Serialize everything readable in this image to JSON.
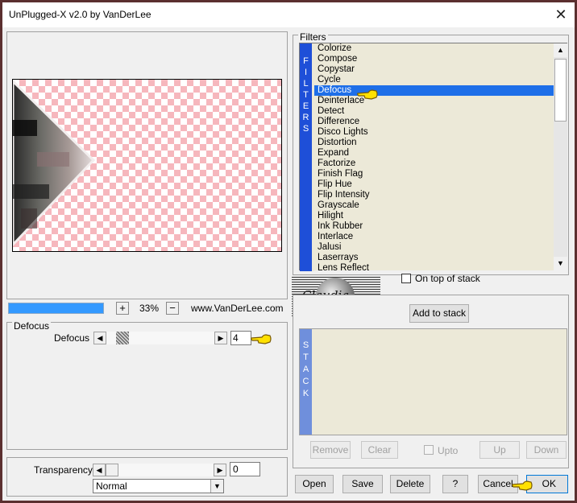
{
  "window": {
    "title": "UnPlugged-X v2.0 by VanDerLee",
    "close_glyph": "✕"
  },
  "filters": {
    "group_label": "Filters",
    "side_label": [
      "F",
      "I",
      "L",
      "T",
      "E",
      "R",
      "S"
    ],
    "items": [
      "Colorize",
      "Compose",
      "Copystar",
      "Cycle",
      "Defocus",
      "Deinterlace",
      "Detect",
      "Difference",
      "Disco Lights",
      "Distortion",
      "Expand",
      "Factorize",
      "Finish Flag",
      "Flip Hue",
      "Flip Intensity",
      "Grayscale",
      "Hilight",
      "Ink Rubber",
      "Interlace",
      "Jalusi",
      "Laserrays",
      "Lens Reflect"
    ],
    "selected": "Defocus",
    "on_top_label": "On top of stack"
  },
  "zoom": {
    "minus": "−",
    "plus": "+",
    "value": "33%",
    "website": "www.VanDerLee.com"
  },
  "params": {
    "group_label": "Defocus",
    "defocus_label": "Defocus",
    "defocus_value": "4",
    "transparency_label": "Transparency",
    "transparency_value": "0",
    "blend_mode": "Normal"
  },
  "stack": {
    "add_label": "Add to stack",
    "side_label": [
      "S",
      "T",
      "A",
      "C",
      "K"
    ],
    "remove_label": "Remove",
    "clear_label": "Clear",
    "upto_label": "Upto",
    "up_label": "Up",
    "down_label": "Down",
    "watermark": "Claudia"
  },
  "footer": {
    "open_label": "Open",
    "save_label": "Save",
    "delete_label": "Delete",
    "help_label": "?",
    "cancel_label": "Cancel",
    "ok_label": "OK"
  },
  "colors": {
    "selection": "#1e6fe8",
    "progress": "#3399ff",
    "list_bg": "#ece9d8",
    "side_blue": "#1e4fd8",
    "stack_side": "#6f8fdc"
  }
}
